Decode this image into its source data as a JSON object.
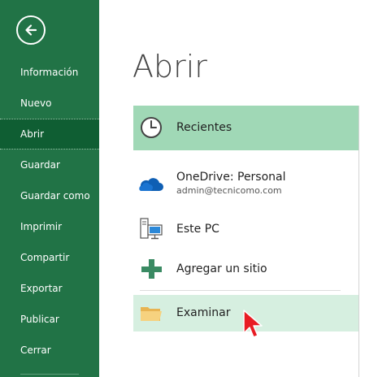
{
  "sidebar": {
    "items": [
      {
        "label": "Información"
      },
      {
        "label": "Nuevo"
      },
      {
        "label": "Abrir"
      },
      {
        "label": "Guardar"
      },
      {
        "label": "Guardar como"
      },
      {
        "label": "Imprimir"
      },
      {
        "label": "Compartir"
      },
      {
        "label": "Exportar"
      },
      {
        "label": "Publicar"
      },
      {
        "label": "Cerrar"
      }
    ],
    "selected": "Abrir"
  },
  "main": {
    "title": "Abrir",
    "locations": [
      {
        "label": "Recientes",
        "icon": "clock-icon",
        "selected": true
      },
      {
        "label": "OneDrive: Personal",
        "sublabel": "admin@tecnicomo.com",
        "icon": "cloud-icon"
      },
      {
        "label": "Este PC",
        "icon": "computer-icon"
      },
      {
        "label": "Agregar un sitio",
        "icon": "plus-icon"
      },
      {
        "label": "Examinar",
        "icon": "folder-icon",
        "hover": true
      }
    ]
  },
  "colors": {
    "sidebar_bg": "#217346",
    "sidebar_selected": "#0f5e33",
    "recientes_bg": "#a0d8b6",
    "examinar_hover_bg": "#d6efe0",
    "plus_green": "#3a8a63"
  }
}
